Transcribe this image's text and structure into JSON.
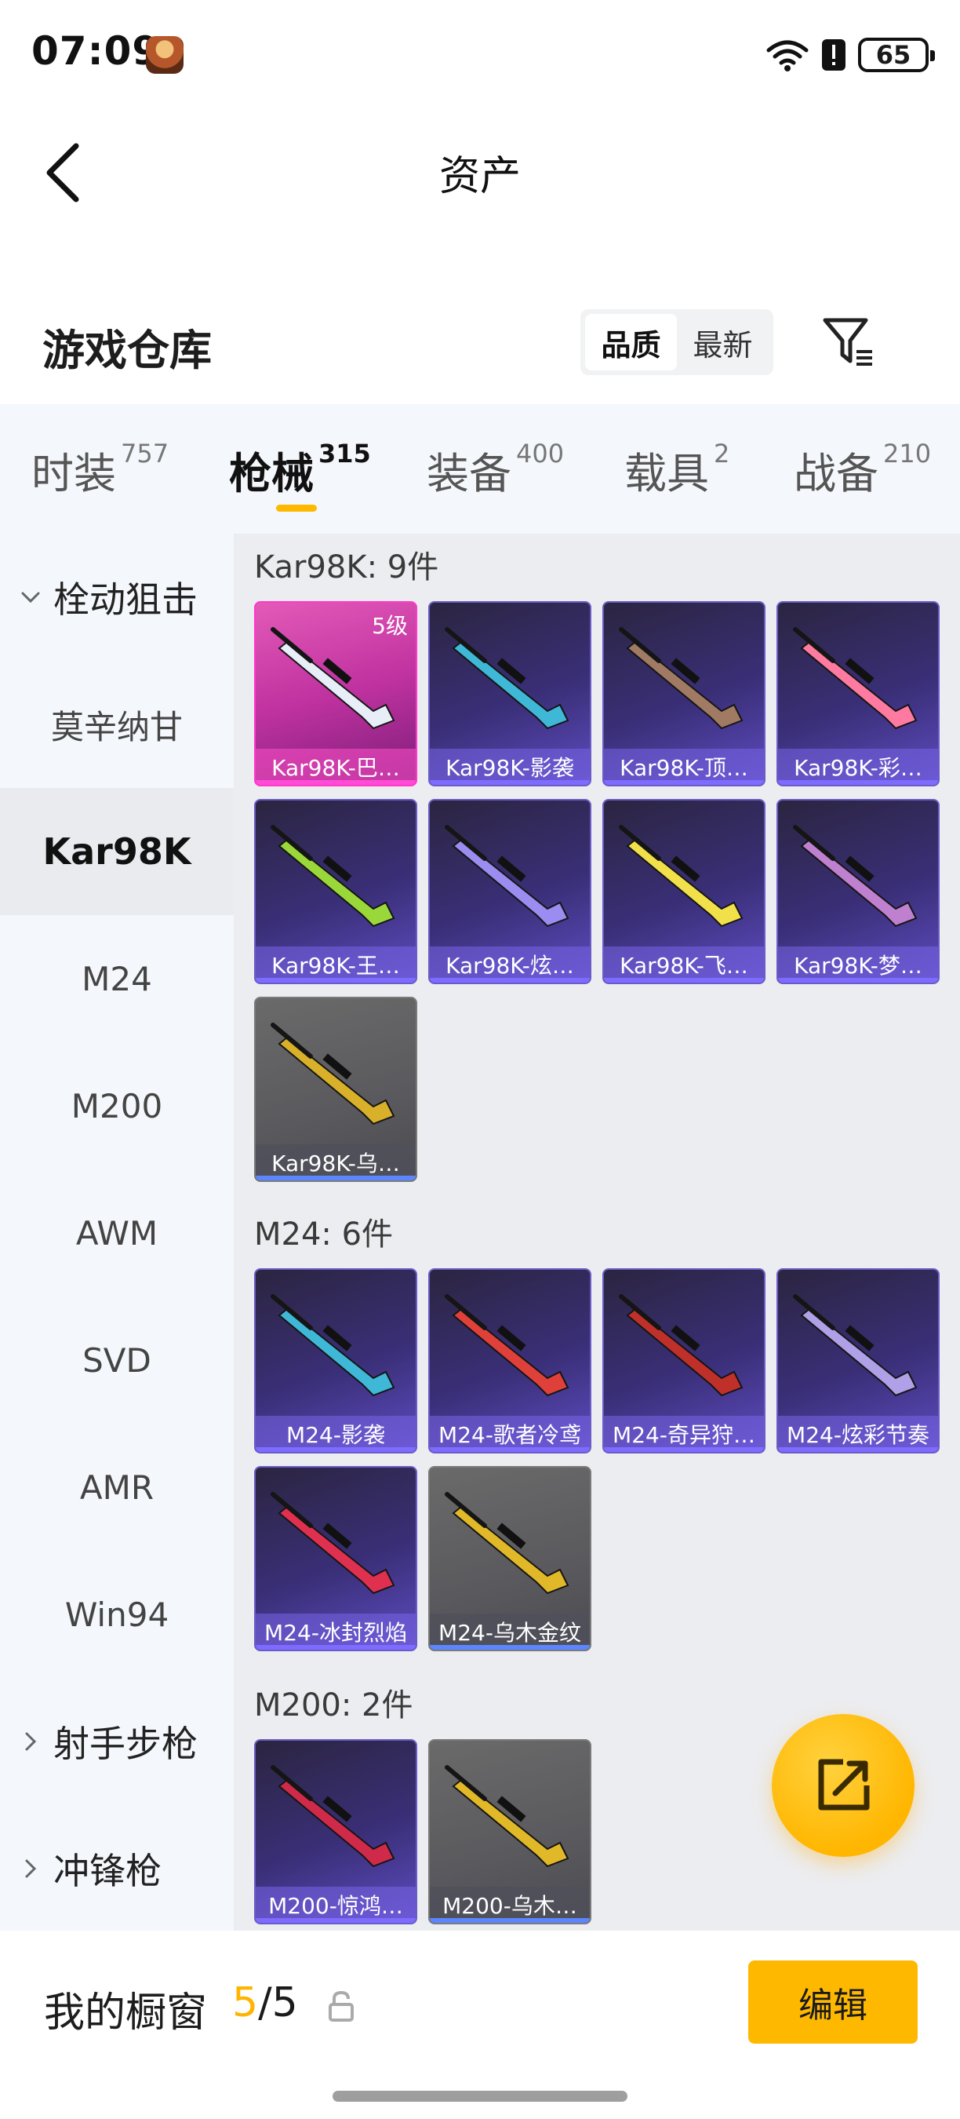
{
  "status_bar": {
    "time": "07:09",
    "battery": "65",
    "icons": [
      "wifi-icon",
      "alert-icon",
      "battery-icon"
    ]
  },
  "nav": {
    "title": "资产",
    "back_icon": "back-chevron-icon"
  },
  "warehouse": {
    "title": "游戏仓库",
    "sort_options": [
      {
        "label": "品质",
        "active": true
      },
      {
        "label": "最新",
        "active": false
      }
    ],
    "filter_icon": "filter-icon"
  },
  "tabs": [
    {
      "label": "时装",
      "count": "757",
      "active": false
    },
    {
      "label": "枪械",
      "count": "315",
      "active": true
    },
    {
      "label": "装备",
      "count": "400",
      "active": false
    },
    {
      "label": "载具",
      "count": "2",
      "active": false
    },
    {
      "label": "战备",
      "count": "210",
      "active": false
    }
  ],
  "sidebar": {
    "items": [
      {
        "label": "栓动狙击",
        "type": "group",
        "expanded": true
      },
      {
        "label": "莫辛纳甘",
        "type": "item"
      },
      {
        "label": "Kar98K",
        "type": "item",
        "active": true
      },
      {
        "label": "M24",
        "type": "item"
      },
      {
        "label": "M200",
        "type": "item"
      },
      {
        "label": "AWM",
        "type": "item"
      },
      {
        "label": "SVD",
        "type": "item"
      },
      {
        "label": "AMR",
        "type": "item"
      },
      {
        "label": "Win94",
        "type": "item"
      },
      {
        "label": "射手步枪",
        "type": "group",
        "expanded": false
      },
      {
        "label": "冲锋枪",
        "type": "group",
        "expanded": false
      }
    ]
  },
  "groups": [
    {
      "title": "Kar98K: 9件",
      "items": [
        {
          "name": "Kar98K-巴…",
          "tier": "pink",
          "level": "5级",
          "gun_color": "#e8eef8"
        },
        {
          "name": "Kar98K-影袭",
          "tier": "purple",
          "gun_color": "#3fb8d8"
        },
        {
          "name": "Kar98K-顶…",
          "tier": "purple",
          "gun_color": "#a07a62"
        },
        {
          "name": "Kar98K-彩…",
          "tier": "purple",
          "gun_color": "#ff7aa0"
        },
        {
          "name": "Kar98K-王…",
          "tier": "purple",
          "gun_color": "#9ad83a"
        },
        {
          "name": "Kar98K-炫…",
          "tier": "purple",
          "gun_color": "#9a8cf0"
        },
        {
          "name": "Kar98K-飞…",
          "tier": "purple",
          "gun_color": "#f2e04a"
        },
        {
          "name": "Kar98K-梦…",
          "tier": "purple",
          "gun_color": "#c080d0"
        },
        {
          "name": "Kar98K-乌…",
          "tier": "grey",
          "gun_color": "#d8b02a"
        }
      ]
    },
    {
      "title": "M24: 6件",
      "items": [
        {
          "name": "M24-影袭",
          "tier": "purple",
          "gun_color": "#3fb8d8"
        },
        {
          "name": "M24-歌者冷鸢",
          "tier": "purple",
          "gun_color": "#e0403a"
        },
        {
          "name": "M24-奇异狩…",
          "tier": "purple",
          "gun_color": "#c0302a"
        },
        {
          "name": "M24-炫彩节奏",
          "tier": "purple",
          "gun_color": "#b0a0e8"
        },
        {
          "name": "M24-冰封烈焰",
          "tier": "purple",
          "gun_color": "#e03050"
        },
        {
          "name": "M24-乌木金纹",
          "tier": "grey",
          "gun_color": "#e0b828"
        }
      ]
    },
    {
      "title": "M200: 2件",
      "items": [
        {
          "name": "M200-惊鸿…",
          "tier": "purple",
          "gun_color": "#d02a4a"
        },
        {
          "name": "M200-乌木…",
          "tier": "grey",
          "gun_color": "#e0b828"
        }
      ]
    }
  ],
  "fab": {
    "icon": "share-external-icon"
  },
  "bottom": {
    "label": "我的橱窗",
    "count_current": "5",
    "count_sep": "/",
    "count_total": "5",
    "lock_icon": "lock-icon",
    "edit_label": "编辑"
  },
  "colors": {
    "accent": "#ffb800",
    "pink_tier": "#ff38c8",
    "purple_tier": "#6a5cc7",
    "grey_tier": "#7a7a7a"
  }
}
